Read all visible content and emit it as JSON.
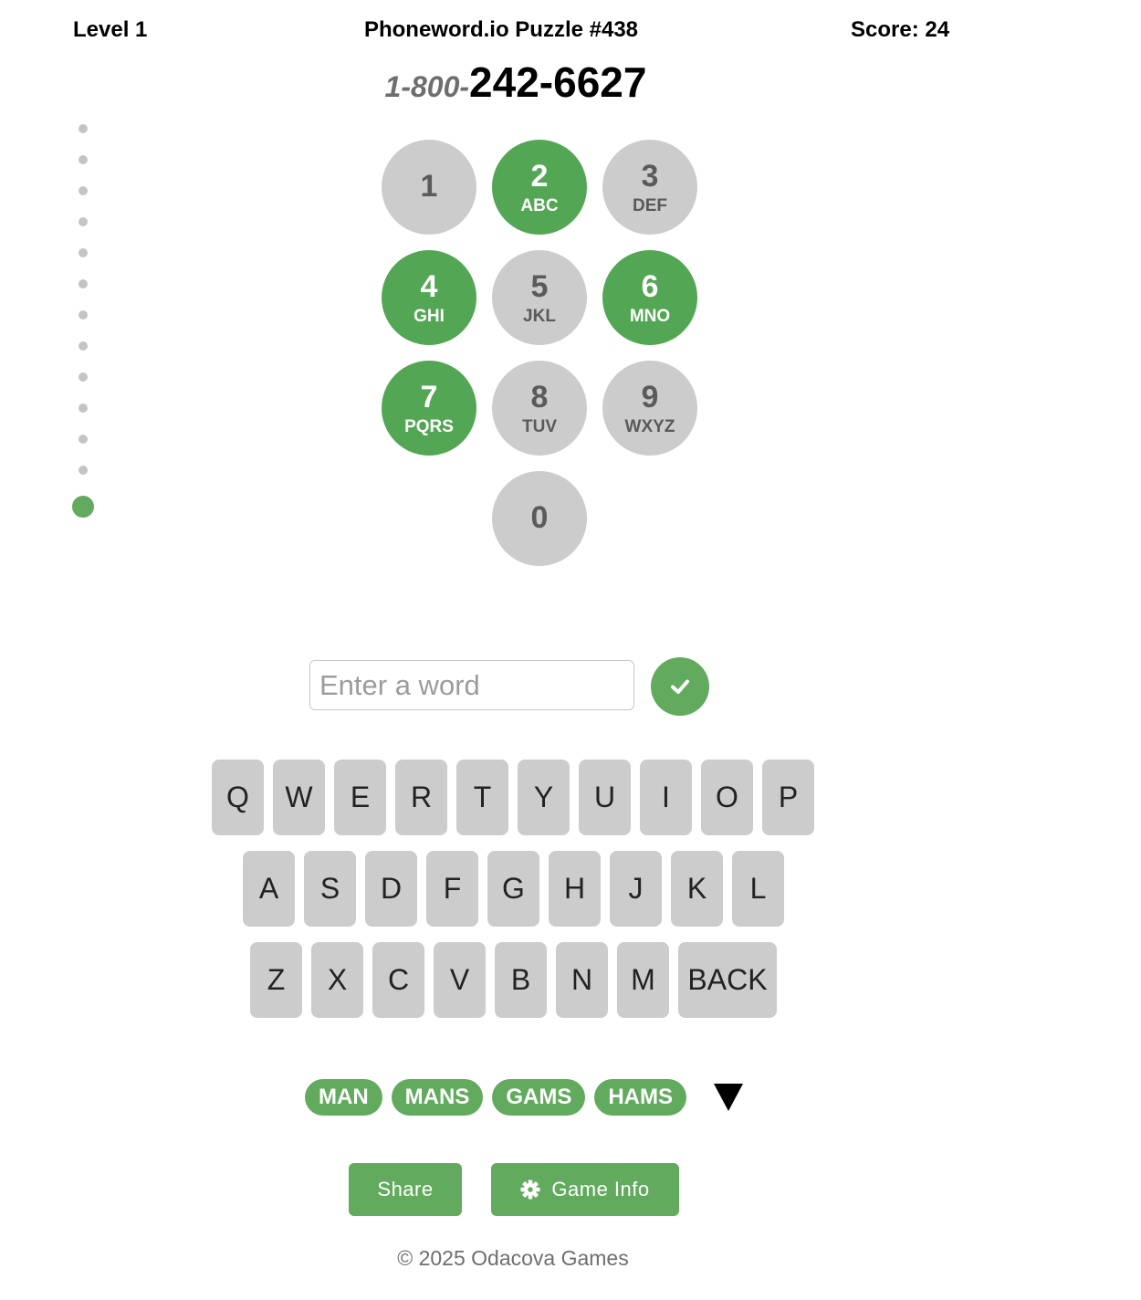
{
  "header": {
    "level": "Level 1",
    "title": "Phoneword.io Puzzle #438",
    "score": "Score: 24"
  },
  "phone": {
    "prefix": "1-800-",
    "number": "242-6627"
  },
  "progress": {
    "total": 13,
    "current": 13
  },
  "keypad": {
    "keys": [
      {
        "digit": "1",
        "letters": "",
        "active": false
      },
      {
        "digit": "2",
        "letters": "ABC",
        "active": true
      },
      {
        "digit": "3",
        "letters": "DEF",
        "active": false
      },
      {
        "digit": "4",
        "letters": "GHI",
        "active": true
      },
      {
        "digit": "5",
        "letters": "JKL",
        "active": false
      },
      {
        "digit": "6",
        "letters": "MNO",
        "active": true
      },
      {
        "digit": "7",
        "letters": "PQRS",
        "active": true
      },
      {
        "digit": "8",
        "letters": "TUV",
        "active": false
      },
      {
        "digit": "9",
        "letters": "WXYZ",
        "active": false
      },
      {
        "digit": "0",
        "letters": "",
        "active": false
      }
    ]
  },
  "entry": {
    "placeholder": "Enter a word",
    "value": "",
    "submit_icon": "check-icon"
  },
  "keyboard": {
    "rows": [
      [
        "Q",
        "W",
        "E",
        "R",
        "T",
        "Y",
        "U",
        "I",
        "O",
        "P"
      ],
      [
        "A",
        "S",
        "D",
        "F",
        "G",
        "H",
        "J",
        "K",
        "L"
      ],
      [
        "Z",
        "X",
        "C",
        "V",
        "B",
        "N",
        "M",
        "BACK"
      ]
    ]
  },
  "found_words": [
    "MAN",
    "MANS",
    "GAMS",
    "HAMS"
  ],
  "found_toggle_icon": "triangle-down-icon",
  "buttons": {
    "share": "Share",
    "game_info": "Game Info",
    "game_info_icon": "gear-icon"
  },
  "footer": "© 2025 Odacova Games",
  "colors": {
    "accent": "#62ab5e",
    "key_active": "#53a653",
    "key_inactive": "#cccccc"
  }
}
